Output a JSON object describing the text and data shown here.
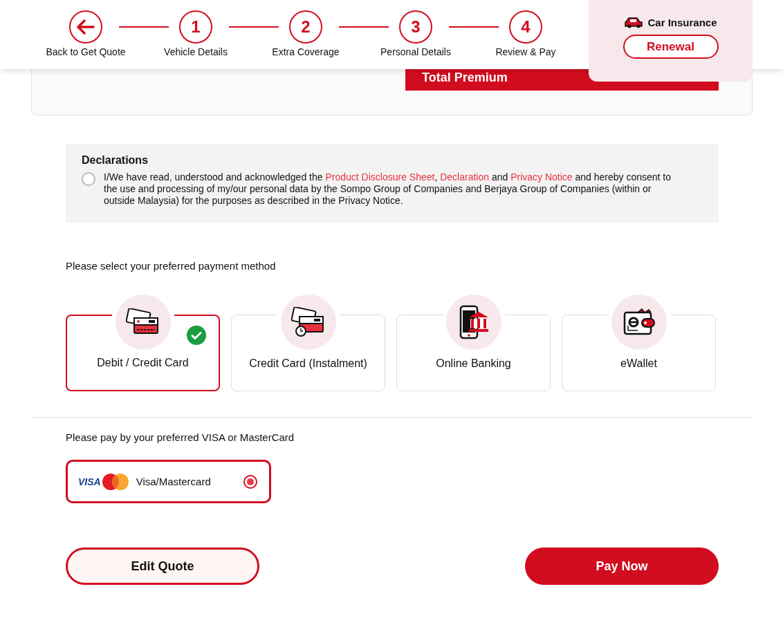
{
  "steps": [
    {
      "kind": "back",
      "label": "Back to Get Quote"
    },
    {
      "kind": "number",
      "number": "1",
      "label": "Vehicle Details"
    },
    {
      "kind": "number",
      "number": "2",
      "label": "Extra Coverage"
    },
    {
      "kind": "number",
      "number": "3",
      "label": "Personal Details"
    },
    {
      "kind": "number",
      "number": "4",
      "label": "Review & Pay"
    }
  ],
  "summary": {
    "label": "Total Premium"
  },
  "product": {
    "title": "Car Insurance",
    "badge": "Renewal"
  },
  "declarations": {
    "title": "Declarations",
    "checked": false,
    "parts": [
      {
        "kind": "text",
        "text": "I/We have read, understood and acknowledged the "
      },
      {
        "kind": "link",
        "text": "Product Disclosure Sheet"
      },
      {
        "kind": "text",
        "text": ", "
      },
      {
        "kind": "link",
        "text": "Declaration"
      },
      {
        "kind": "text",
        "text": " and "
      },
      {
        "kind": "link",
        "text": "Privacy Notice"
      },
      {
        "kind": "text",
        "text": " and hereby consent to the use and processing of my/our personal data by the Sompo Group of Companies and Berjaya Group of Companies (within or outside Malaysia) for the purposes as described in the Privacy Notice."
      }
    ]
  },
  "payment": {
    "prompt": "Please select your preferred payment method",
    "methods": [
      {
        "kind": "cards",
        "label": "Debit / Credit Card",
        "selected": true
      },
      {
        "kind": "instalment",
        "label": "Credit Card (Instalment)",
        "selected": false
      },
      {
        "kind": "bank",
        "label": "Online Banking",
        "selected": false
      },
      {
        "kind": "wallet",
        "label": "eWallet",
        "selected": false
      }
    ]
  },
  "card_options": {
    "prompt": "Please pay by your preferred VISA or MasterCard",
    "options": [
      {
        "logo_text": "VISA",
        "label": "Visa/Mastercard",
        "selected": true
      }
    ]
  },
  "buttons": [
    {
      "kind": "secondary",
      "label": "Edit Quote"
    },
    {
      "kind": "primary",
      "label": "Pay Now"
    }
  ]
}
